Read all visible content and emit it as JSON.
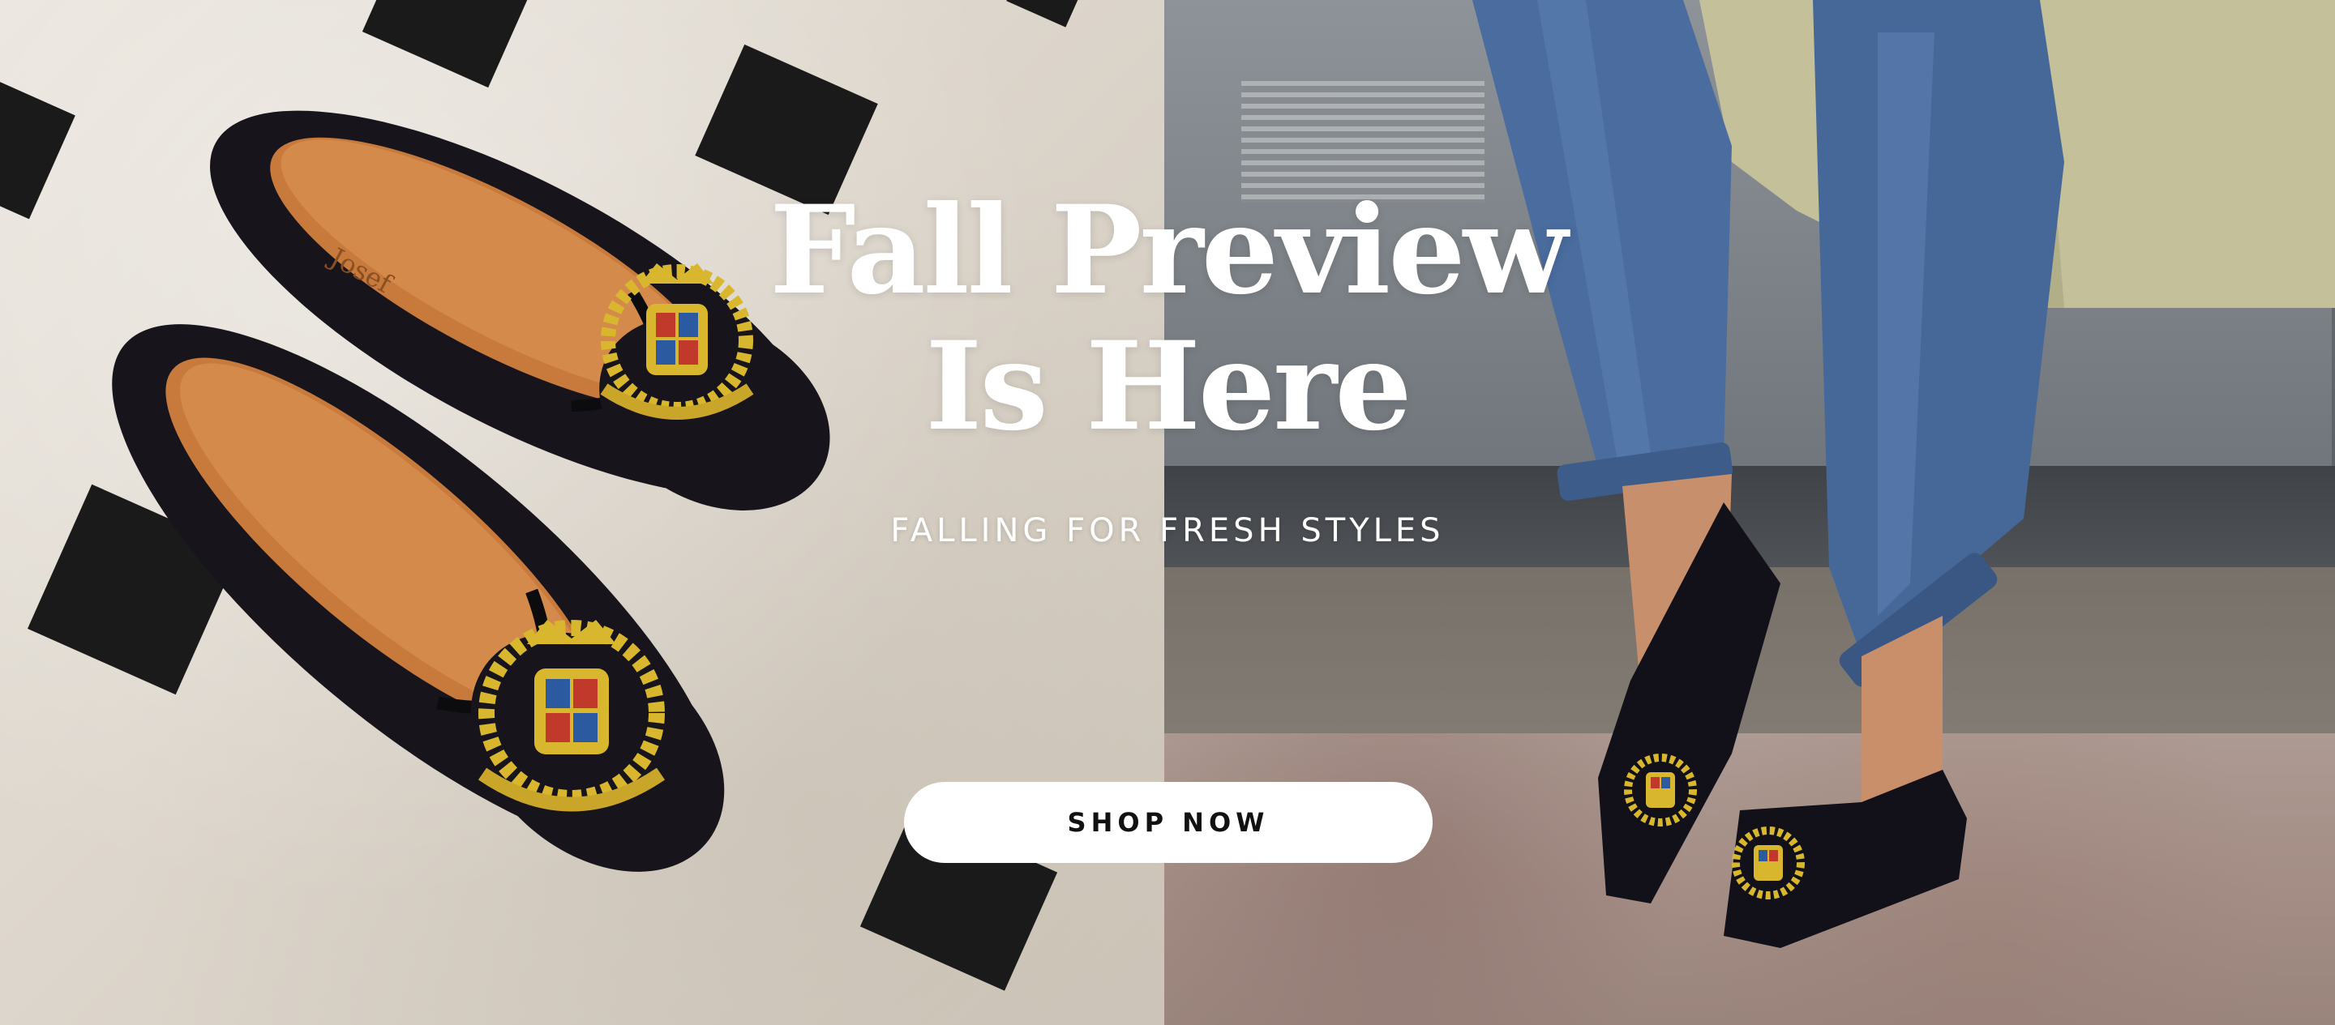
{
  "hero": {
    "headline_line1": "Fall Preview",
    "headline_line2": "Is Here",
    "subheadline": "FALLING FOR FRESH STYLES",
    "cta_label": "SHOP NOW"
  },
  "left_image": {
    "subject": "black velvet loafers with gold embroidered crest on marble floor",
    "insole_brand": "Josef"
  },
  "right_image": {
    "subject": "person wearing cropped jeans and black velvet crest loafers on street"
  },
  "colors": {
    "headline_text": "#ffffff",
    "cta_background": "#ffffff",
    "cta_text": "#111111",
    "loafer_velvet": "#16141c",
    "crest_gold": "#d8b72e",
    "insole_leather": "#c77a3c",
    "denim": "#46679a"
  }
}
